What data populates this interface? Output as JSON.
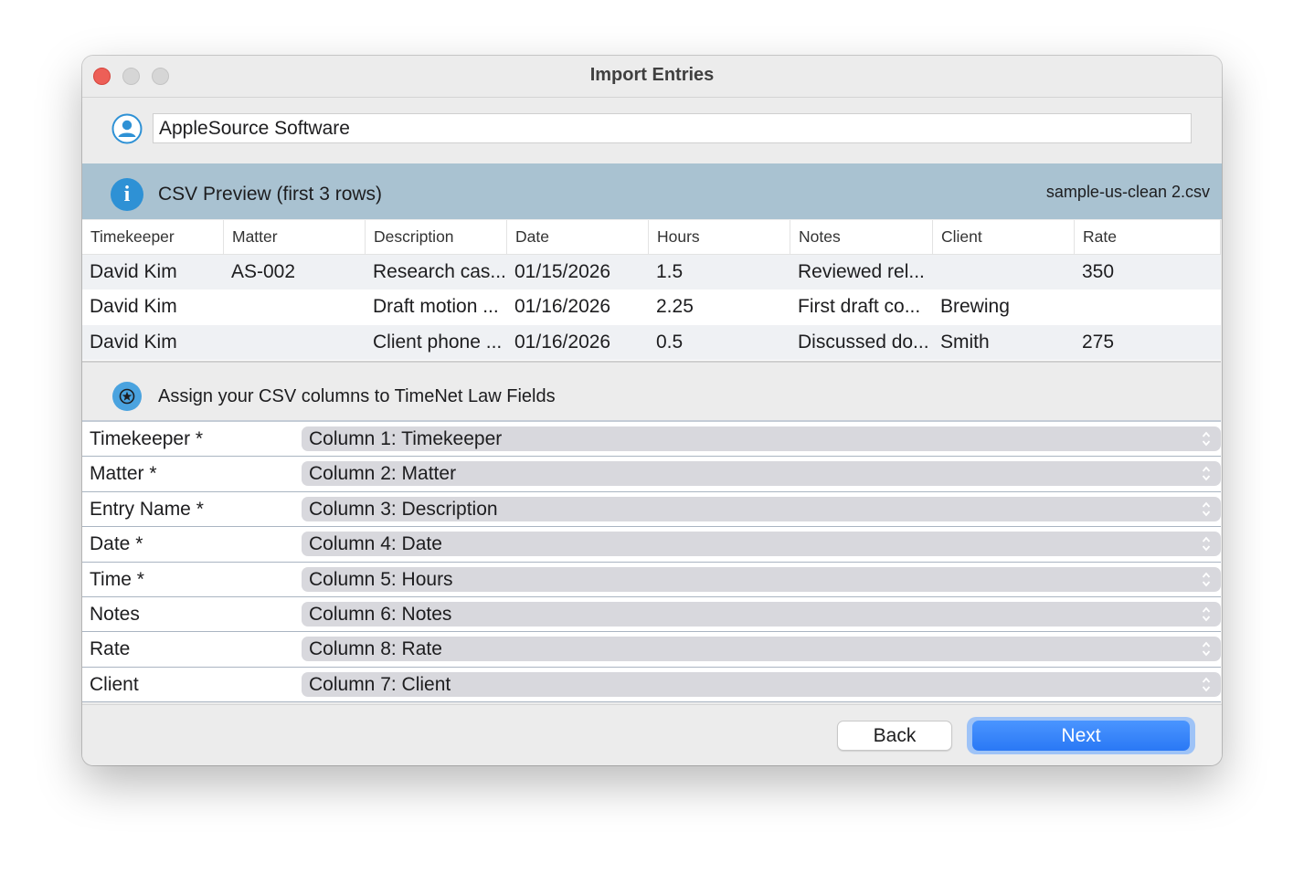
{
  "window": {
    "title": "Import Entries"
  },
  "client": {
    "value": "AppleSource Software",
    "icon": "person-icon"
  },
  "csv": {
    "title": "CSV Preview (first 3 rows)",
    "filename": "sample-us-clean 2.csv",
    "icon": "info-icon",
    "columns": [
      "Timekeeper",
      "Matter",
      "Description",
      "Date",
      "Hours",
      "Notes",
      "Client",
      "Rate"
    ],
    "rows": [
      [
        "David Kim",
        "AS-002",
        "Research cas...",
        "01/15/2026",
        "1.5",
        "Reviewed rel...",
        "",
        "350"
      ],
      [
        "David Kim",
        "",
        "Draft motion ...",
        "01/16/2026",
        "2.25",
        "First draft co...",
        "Brewing",
        ""
      ],
      [
        "David Kim",
        "",
        "Client phone ...",
        "01/16/2026",
        "0.5",
        "Discussed do...",
        "Smith",
        "275"
      ]
    ]
  },
  "assign": {
    "title": "Assign your CSV columns to TimeNet Law Fields",
    "icon": "star-icon",
    "fields": [
      {
        "label": "Timekeeper *",
        "value": "Column 1: Timekeeper"
      },
      {
        "label": "Matter *",
        "value": "Column 2: Matter"
      },
      {
        "label": "Entry Name *",
        "value": "Column 3: Description"
      },
      {
        "label": "Date *",
        "value": "Column 4: Date"
      },
      {
        "label": "Time *",
        "value": "Column 5: Hours"
      },
      {
        "label": "Notes",
        "value": "Column 6: Notes"
      },
      {
        "label": "Rate",
        "value": "Column 8: Rate"
      },
      {
        "label": "Client",
        "value": "Column 7: Client"
      }
    ]
  },
  "footer": {
    "back_label": "Back",
    "next_label": "Next"
  },
  "colors": {
    "accent": "#2a78f5",
    "header_band": "#a9c2d1",
    "info_blue": "#2e91d5",
    "close_red": "#ed5f57"
  }
}
